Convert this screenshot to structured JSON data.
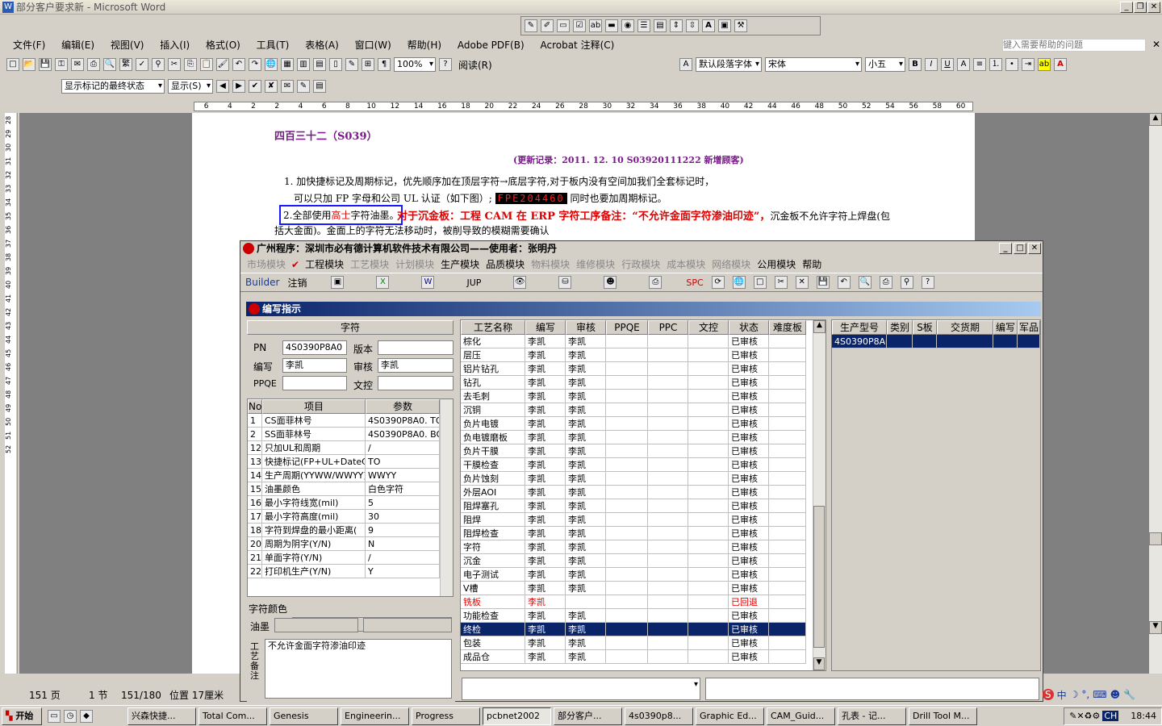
{
  "window": {
    "title": "部分客户要求新 - Microsoft Word"
  },
  "menu": [
    "文件(F)",
    "编辑(E)",
    "视图(V)",
    "插入(I)",
    "格式(O)",
    "工具(T)",
    "表格(A)",
    "窗口(W)",
    "帮助(H)",
    "Adobe PDF(B)",
    "Acrobat 注释(C)"
  ],
  "help_box": {
    "placeholder": "键入需要帮助的问题"
  },
  "toolbar": {
    "zoom": "100%",
    "read_btn": "阅读(R)",
    "style": "默认段落字体",
    "font": "宋体",
    "size": "小五",
    "markup": "显示标记的最终状态",
    "show": "显示(S)"
  },
  "ruler_ticks": [
    "6",
    "4",
    "2",
    "2",
    "4",
    "6",
    "8",
    "10",
    "12",
    "14",
    "16",
    "18",
    "20",
    "22",
    "24",
    "26",
    "28",
    "30",
    "32",
    "34",
    "36",
    "38",
    "40",
    "42",
    "44",
    "46",
    "48",
    "50",
    "52",
    "54",
    "56",
    "58",
    "60"
  ],
  "vruler_ticks": [
    "28",
    "29",
    "30",
    "31",
    "32",
    "33",
    "34",
    "35",
    "36",
    "37",
    "38",
    "39",
    "40",
    "41",
    "42",
    "43",
    "44",
    "45",
    "46",
    "47",
    "48",
    "49",
    "50",
    "51",
    "52"
  ],
  "doc": {
    "heading": "四百三十二（S039）",
    "update": "(更新记录：2011. 12. 10       S03920111222      新增顾客)",
    "line1": "1. 加快捷标记及周期标记，优先顺序加在顶层字符→底层字符,对于板内没有空间加我们全套标记时，",
    "line2a": "可以只加 FP 字母和公司 UL 认证（如下图）;",
    "line2_img": "FPE204460",
    "line2b": "同时也要加周期标记。",
    "line3_box_a": "2.全部使用",
    "line3_box_red": "高士",
    "line3_box_b": "字符油墨。",
    "line3_red": "对于沉金板：工程 CAM 在 ERP 字符工序备注：“不允许金面字符渗油印迹”，",
    "line3_rest": "沉金板不允许字符上焊盘(包",
    "line4": "括大金面)。金面上的字符无法移动时，被削导致的模糊需要确认"
  },
  "status": {
    "page": "151 页",
    "section": "1 节",
    "pages": "151/180",
    "position": "位置 17厘米"
  },
  "taskbar": {
    "start": "开始",
    "tasks": [
      "兴森快捷...",
      "Total Com...",
      "Genesis",
      "Engineerin...",
      "Progress",
      "pcbnet2002",
      "部分客户...",
      "4s0390p8...",
      "Graphic Ed...",
      "CAM_Guid...",
      "孔表 - 记...",
      "Drill Tool M..."
    ],
    "active": 5,
    "clock": "18:44",
    "ime": "CH"
  },
  "app": {
    "title": "广州程序：深圳市必有德计算机软件技术有限公司——使用者：张明丹",
    "menu": [
      {
        "label": "市场模块",
        "on": false
      },
      {
        "label": "工程模块",
        "on": true
      },
      {
        "label": "工艺模块",
        "on": false
      },
      {
        "label": "计划模块",
        "on": false
      },
      {
        "label": "生产模块",
        "on": true
      },
      {
        "label": "品质模块",
        "on": true
      },
      {
        "label": "物料模块",
        "on": false
      },
      {
        "label": "维修模块",
        "on": false
      },
      {
        "label": "行政模块",
        "on": false
      },
      {
        "label": "成本模块",
        "on": false
      },
      {
        "label": "网络模块",
        "on": false
      },
      {
        "label": "公用模块",
        "on": true
      },
      {
        "label": "帮助",
        "on": true
      }
    ],
    "tools": {
      "builder": "Builder",
      "logout": "注销",
      "jup": "JUP",
      "spc": "SPC"
    },
    "child_title": "编写指示",
    "left": {
      "section": "字符",
      "pn_label": "PN",
      "pn": "4S0390P8A0",
      "ver_label": "版本",
      "ver": "",
      "writer_label": "编写",
      "writer": "李凯",
      "audit_label": "审核",
      "audit": "李凯",
      "ppqe_label": "PPQE",
      "ppqe": "",
      "doc_label": "文控",
      "doc": "",
      "params_headers": [
        "No",
        "项目",
        "参数"
      ],
      "params": [
        [
          "1",
          "CS面菲林号",
          "4S0390P8A0. TO"
        ],
        [
          "2",
          "SS面菲林号",
          "4S0390P8A0. BO"
        ],
        [
          "12",
          "只加UL和周期",
          "/"
        ],
        [
          "13",
          "快捷标记(FP+UL+DateCo",
          "TO"
        ],
        [
          "14",
          "生产周期(YYWW/WWYY)",
          "WWYY"
        ],
        [
          "15",
          "油墨颜色",
          "白色字符"
        ],
        [
          "16",
          "最小字符线宽(mil)",
          "5"
        ],
        [
          "17",
          "最小字符高度(mil)",
          "30"
        ],
        [
          "18",
          "字符到焊盘的最小距离(",
          "9"
        ],
        [
          "20",
          "周期为阴字(Y/N)",
          "N"
        ],
        [
          "21",
          "单面字符(Y/N)",
          "/"
        ],
        [
          "22",
          "打印机生产(Y/N)",
          "Y"
        ]
      ],
      "color_label": "字符颜色",
      "ink_label": "油墨",
      "remark_label": "工艺备注",
      "remark": "不允许金面字符渗油印迹"
    },
    "mid": {
      "headers": [
        "工艺名称",
        "编写",
        "审核",
        "PPQE",
        "PPC",
        "文控",
        "状态",
        "难度板"
      ],
      "rows": [
        [
          "棕化",
          "李凯",
          "李凯",
          "",
          "",
          "",
          "已审核",
          ""
        ],
        [
          "层压",
          "李凯",
          "李凯",
          "",
          "",
          "",
          "已审核",
          ""
        ],
        [
          "铝片钻孔",
          "李凯",
          "李凯",
          "",
          "",
          "",
          "已审核",
          ""
        ],
        [
          "钻孔",
          "李凯",
          "李凯",
          "",
          "",
          "",
          "已审核",
          ""
        ],
        [
          "去毛刺",
          "李凯",
          "李凯",
          "",
          "",
          "",
          "已审核",
          ""
        ],
        [
          "沉铜",
          "李凯",
          "李凯",
          "",
          "",
          "",
          "已审核",
          ""
        ],
        [
          "负片电镀",
          "李凯",
          "李凯",
          "",
          "",
          "",
          "已审核",
          ""
        ],
        [
          "负电镀磨板",
          "李凯",
          "李凯",
          "",
          "",
          "",
          "已审核",
          ""
        ],
        [
          "负片干膜",
          "李凯",
          "李凯",
          "",
          "",
          "",
          "已审核",
          ""
        ],
        [
          "干膜检查",
          "李凯",
          "李凯",
          "",
          "",
          "",
          "已审核",
          ""
        ],
        [
          "负片蚀刻",
          "李凯",
          "李凯",
          "",
          "",
          "",
          "已审核",
          ""
        ],
        [
          "外层AOI",
          "李凯",
          "李凯",
          "",
          "",
          "",
          "已审核",
          ""
        ],
        [
          "阻焊塞孔",
          "李凯",
          "李凯",
          "",
          "",
          "",
          "已审核",
          ""
        ],
        [
          "阻焊",
          "李凯",
          "李凯",
          "",
          "",
          "",
          "已审核",
          ""
        ],
        [
          "阻焊检查",
          "李凯",
          "李凯",
          "",
          "",
          "",
          "已审核",
          ""
        ],
        [
          "字符",
          "李凯",
          "李凯",
          "",
          "",
          "",
          "已审核",
          ""
        ],
        [
          "沉金",
          "李凯",
          "李凯",
          "",
          "",
          "",
          "已审核",
          ""
        ],
        [
          "电子测试",
          "李凯",
          "李凯",
          "",
          "",
          "",
          "已审核",
          ""
        ],
        [
          "V槽",
          "李凯",
          "李凯",
          "",
          "",
          "",
          "已审核",
          ""
        ],
        [
          "铣板",
          "李凯",
          "",
          "",
          "",
          "",
          "已回退",
          ""
        ],
        [
          "功能检查",
          "李凯",
          "李凯",
          "",
          "",
          "",
          "已审核",
          ""
        ],
        [
          "终检",
          "李凯",
          "李凯",
          "",
          "",
          "",
          "已审核",
          ""
        ],
        [
          "包装",
          "李凯",
          "李凯",
          "",
          "",
          "",
          "已审核",
          ""
        ],
        [
          "成品仓",
          "李凯",
          "李凯",
          "",
          "",
          "",
          "已审核",
          ""
        ]
      ],
      "red_row": 19,
      "sel_row": 21
    },
    "right": {
      "headers": [
        "生产型号",
        "类别",
        "S板",
        "交货期",
        "编写",
        "军品"
      ],
      "rows": [
        [
          "4S0390P8A0",
          "",
          "",
          "",
          "",
          ""
        ]
      ]
    }
  }
}
